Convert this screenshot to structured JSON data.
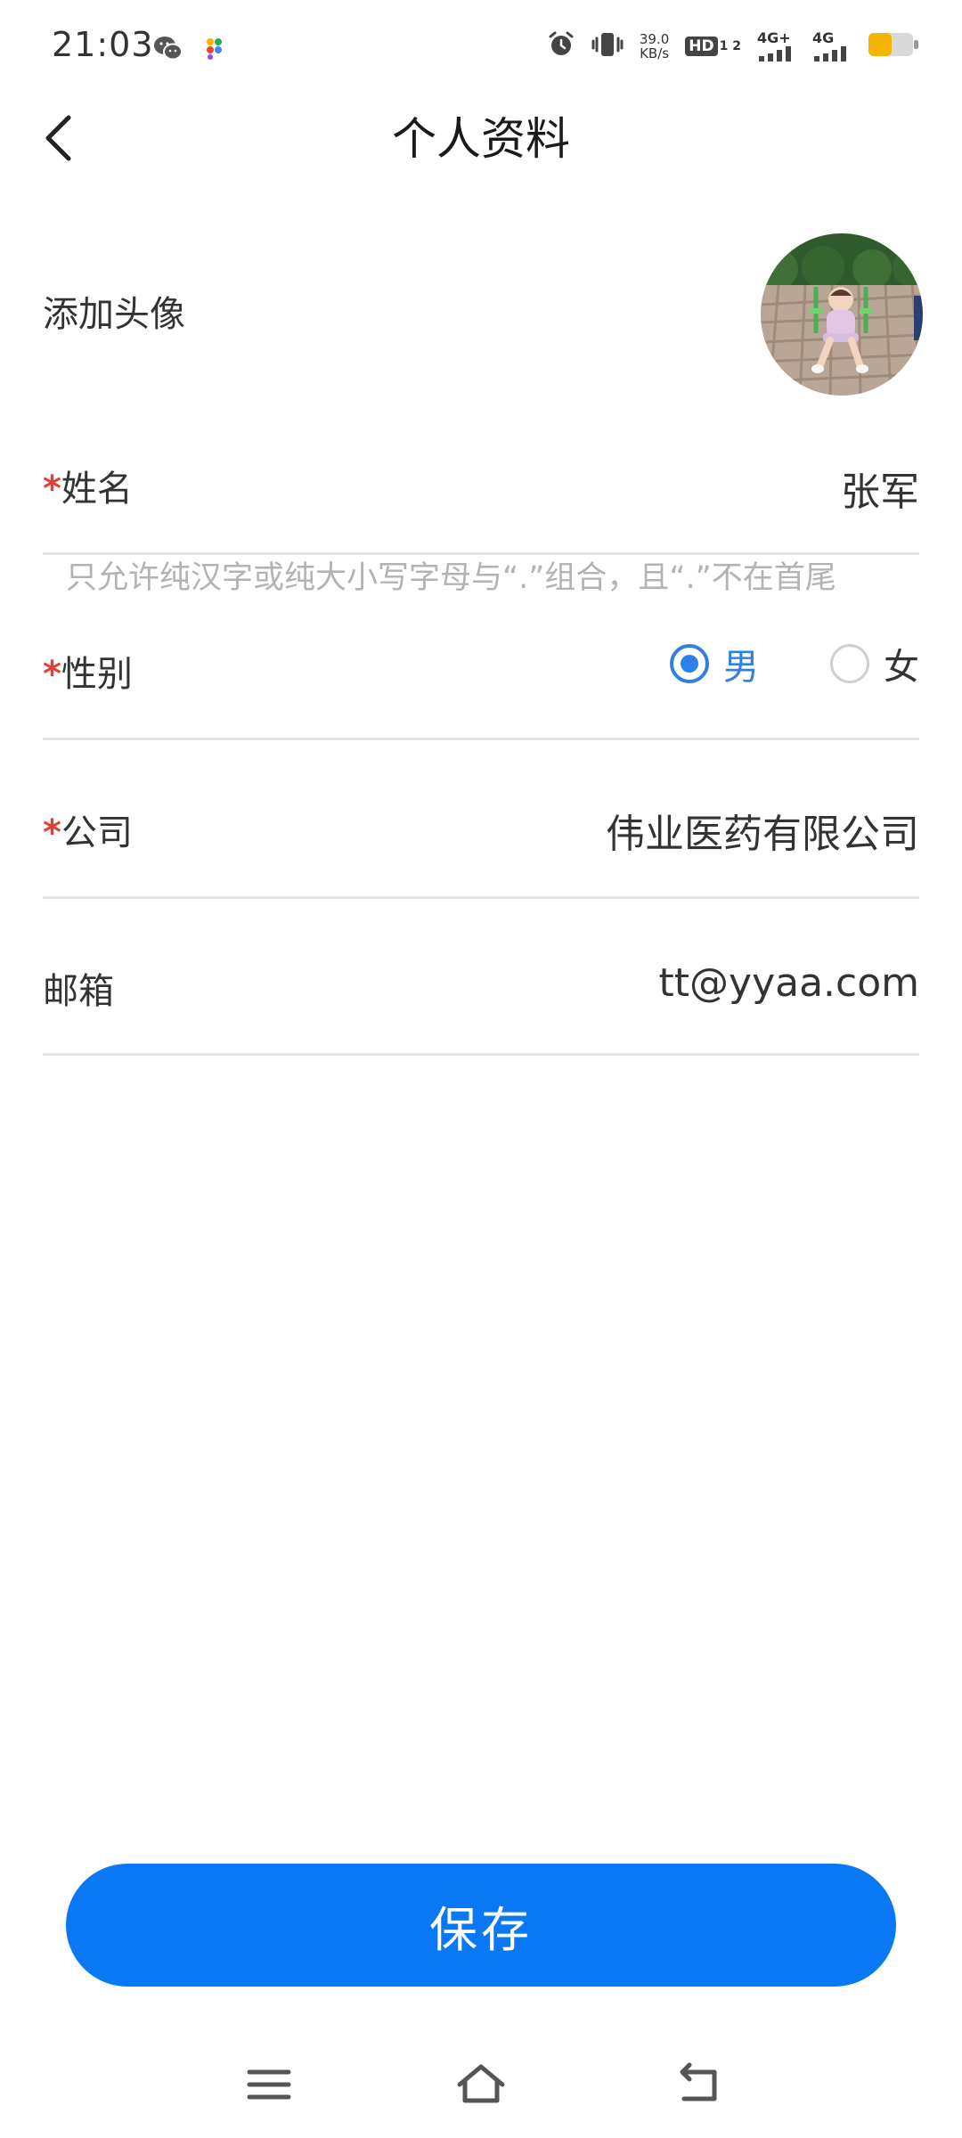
{
  "status_bar": {
    "time": "21:03",
    "left_icons": [
      "wechat-icon",
      "app-color-icon"
    ],
    "net_speed_value": "39.0",
    "net_speed_unit": "KB/s",
    "hd_label": "HD",
    "sim_slots": "1 2",
    "signal_1_label": "4G+",
    "signal_2_label": "4G",
    "battery_color": "#f5b400"
  },
  "header": {
    "title": "个人资料",
    "back_icon": "chevron-left-icon"
  },
  "form": {
    "avatar_label": "添加头像",
    "name": {
      "required_mark": "*",
      "label": "姓名",
      "value": "张军",
      "hint": "只允许纯汉字或纯大小写字母与“.”组合，且“.”不在首尾"
    },
    "gender": {
      "required_mark": "*",
      "label": "性别",
      "options": [
        {
          "label": "男",
          "selected": true
        },
        {
          "label": "女",
          "selected": false
        }
      ]
    },
    "company": {
      "required_mark": "*",
      "label": "公司",
      "value": "伟业医药有限公司"
    },
    "email": {
      "label": "邮箱",
      "value": "tt@yyaa.com"
    }
  },
  "actions": {
    "save_label": "保存"
  },
  "colors": {
    "accent": "#0a78f4",
    "radio_blue": "#2f7fe8",
    "required_red": "#e0403a",
    "hint_gray": "#b3b3b3",
    "divider": "#e4e4e4"
  },
  "nav_bar": {
    "icons": [
      "menu-icon",
      "home-icon",
      "back-nav-icon"
    ]
  }
}
